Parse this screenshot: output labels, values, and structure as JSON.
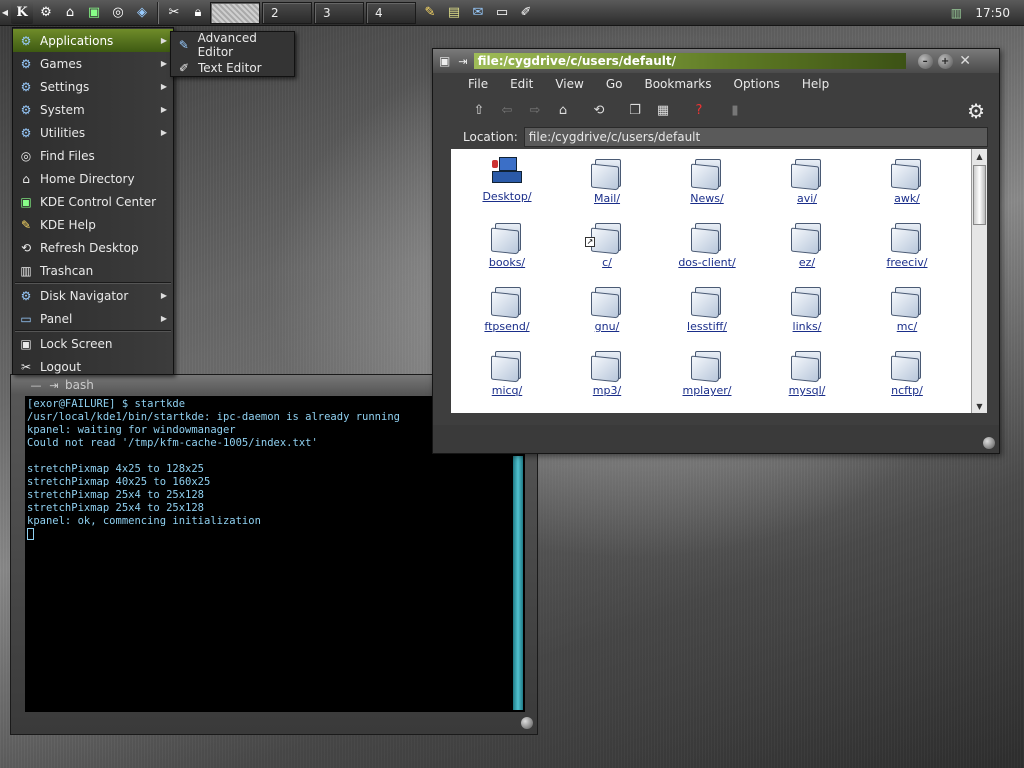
{
  "taskbar": {
    "k_label": "K",
    "desktops": [
      "",
      "2",
      "3",
      "4"
    ],
    "clock": "17:50"
  },
  "kmenu": {
    "items": [
      {
        "label": "Applications",
        "icon": "applications-icon",
        "submenu": true
      },
      {
        "label": "Games",
        "icon": "games-icon",
        "submenu": true
      },
      {
        "label": "Settings",
        "icon": "settings-icon",
        "submenu": true
      },
      {
        "label": "System",
        "icon": "system-icon",
        "submenu": true
      },
      {
        "label": "Utilities",
        "icon": "utilities-icon",
        "submenu": true
      },
      {
        "label": "Find Files",
        "icon": "find-files-icon"
      },
      {
        "label": "Home Directory",
        "icon": "home-icon"
      },
      {
        "label": "KDE Control Center",
        "icon": "control-center-icon"
      },
      {
        "label": "KDE Help",
        "icon": "help-icon"
      },
      {
        "label": "Refresh Desktop",
        "icon": "refresh-icon"
      },
      {
        "label": "Trashcan",
        "icon": "trash-icon"
      },
      {
        "label": "Disk Navigator",
        "icon": "disk-navigator-icon",
        "submenu": true
      },
      {
        "label": "Panel",
        "icon": "panel-icon",
        "submenu": true
      },
      {
        "label": "Lock Screen",
        "icon": "lock-icon"
      },
      {
        "label": "Logout",
        "icon": "logout-icon"
      }
    ],
    "submenu": [
      "Advanced Editor",
      "Text Editor"
    ]
  },
  "terminal": {
    "title": "bash",
    "lines": [
      "[exor@FAILURE] $ startkde",
      "/usr/local/kde1/bin/startkde: ipc-daemon is already running",
      "kpanel: waiting for windowmanager",
      "Could not read '/tmp/kfm-cache-1005/index.txt'",
      "",
      "stretchPixmap 4x25 to 128x25",
      "stretchPixmap 40x25 to 160x25",
      "stretchPixmap 25x4 to 25x128",
      "stretchPixmap 25x4 to 25x128",
      "kpanel: ok, commencing initialization"
    ]
  },
  "filemanager": {
    "title": "file:/cygdrive/c/users/default/",
    "menu": [
      "File",
      "Edit",
      "View",
      "Go",
      "Bookmarks",
      "Options",
      "Help"
    ],
    "location_label": "Location:",
    "location_value": "file:/cygdrive/c/users/default",
    "items": [
      {
        "name": "Desktop/",
        "icon": "desktop"
      },
      {
        "name": "Mail/",
        "icon": "folder"
      },
      {
        "name": "News/",
        "icon": "folder"
      },
      {
        "name": "avi/",
        "icon": "folder"
      },
      {
        "name": "awk/",
        "icon": "folder"
      },
      {
        "name": "books/",
        "icon": "folder"
      },
      {
        "name": "c/",
        "icon": "folder-link"
      },
      {
        "name": "dos-client/",
        "icon": "folder"
      },
      {
        "name": "ez/",
        "icon": "folder"
      },
      {
        "name": "freeciv/",
        "icon": "folder"
      },
      {
        "name": "ftpsend/",
        "icon": "folder"
      },
      {
        "name": "gnu/",
        "icon": "folder"
      },
      {
        "name": "lesstiff/",
        "icon": "folder"
      },
      {
        "name": "links/",
        "icon": "folder"
      },
      {
        "name": "mc/",
        "icon": "folder"
      },
      {
        "name": "micq/",
        "icon": "folder"
      },
      {
        "name": "mp3/",
        "icon": "folder"
      },
      {
        "name": "mplayer/",
        "icon": "folder"
      },
      {
        "name": "mysql/",
        "icon": "folder"
      },
      {
        "name": "ncftp/",
        "icon": "folder"
      }
    ]
  }
}
